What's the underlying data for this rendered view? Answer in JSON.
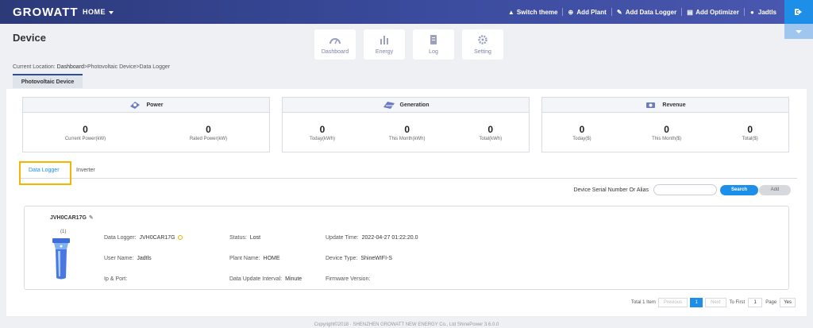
{
  "header": {
    "logo": "GROWATT",
    "home_menu": "HOME",
    "actions": [
      {
        "label": "Switch theme",
        "icon": "shirt-icon"
      },
      {
        "label": "Add Plant",
        "icon": "plus-circle-icon"
      },
      {
        "label": "Add Data Logger",
        "icon": "pencil-icon"
      },
      {
        "label": "Add Optimizer",
        "icon": "optimizer-icon"
      },
      {
        "label": "Jadtls",
        "icon": "user-icon"
      }
    ]
  },
  "page": {
    "title": "Device",
    "breadcrumb_prefix": "Current Location: ",
    "breadcrumb_root": "Dashboard",
    "breadcrumb_rest": ">Photovoltaic Device>Data Logger",
    "device_tab": "Photovoltaic Device"
  },
  "quick_nav": [
    {
      "label": "Dashboard",
      "icon": "gauge-icon"
    },
    {
      "label": "Energy",
      "icon": "bar-chart-icon"
    },
    {
      "label": "Log",
      "icon": "document-icon"
    },
    {
      "label": "Setting",
      "icon": "gear-icon"
    }
  ],
  "stats": {
    "power": {
      "title": "Power",
      "items": [
        {
          "value": "0",
          "label": "Current Power(kW)"
        },
        {
          "value": "0",
          "label": "Rated Power(kW)"
        }
      ]
    },
    "generation": {
      "title": "Generation",
      "items": [
        {
          "value": "0",
          "label": "Today(kWh)"
        },
        {
          "value": "0",
          "label": "This Month(kWh)"
        },
        {
          "value": "0",
          "label": "Total(kWh)"
        }
      ]
    },
    "revenue": {
      "title": "Revenue",
      "items": [
        {
          "value": "0",
          "label": "Today($)"
        },
        {
          "value": "0",
          "label": "This Month($)"
        },
        {
          "value": "0",
          "label": "Total($)"
        }
      ]
    }
  },
  "sub_tabs": {
    "active": "Data Logger",
    "inactive": "Inverter"
  },
  "search": {
    "label": "Device Serial Number Or Alias",
    "placeholder": "",
    "search_btn": "Search",
    "add_btn": "Add"
  },
  "logger": {
    "name": "JVH0CAR17G",
    "count": "(1)",
    "fields": {
      "data_logger_label": "Data Logger:",
      "data_logger_value": "JVH0CAR17G",
      "status_label": "Status:",
      "status_value": "Lost",
      "update_time_label": "Update Time:",
      "update_time_value": "2022-04-27 01:22:20.0",
      "user_name_label": "User Name:",
      "user_name_value": "Jadtls",
      "plant_name_label": "Plant Name:",
      "plant_name_value": "HOME",
      "device_type_label": "Device Type:",
      "device_type_value": "ShineWIFI-S",
      "ip_port_label": "Ip & Port:",
      "ip_port_value": "",
      "data_interval_label": "Data Update Interval:",
      "data_interval_value": "Minute",
      "firmware_label": "Firmware Version:",
      "firmware_value": ""
    }
  },
  "pager": {
    "total": "Total 1 Item",
    "previous": "Previous",
    "current": "1",
    "next": "Next",
    "to_first": "To First",
    "page_input": "1",
    "page_label": "Page",
    "go": "Yes"
  },
  "footer": "Copyright©2018 · SHENZHEN GROWATT NEW ENERGY Co., Ltd ShinePower 3.6.0.0"
}
